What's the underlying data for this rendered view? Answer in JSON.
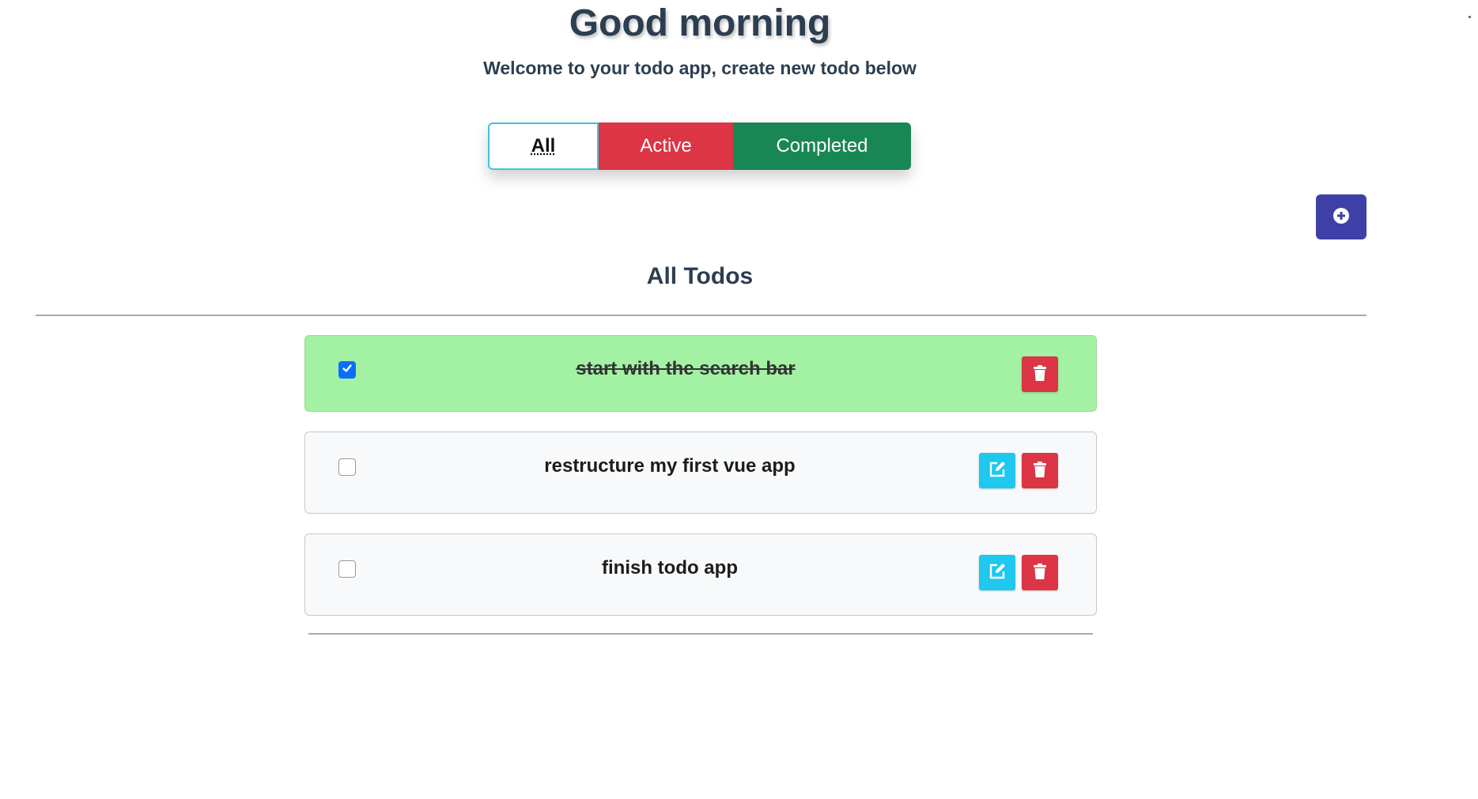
{
  "header": {
    "greeting": "Good morning",
    "subtitle": "Welcome to your todo app, create new todo below"
  },
  "filters": {
    "all_label": "All",
    "active_label": "Active",
    "completed_label": "Completed",
    "selected": "All"
  },
  "add_button": {
    "icon": "plus-circle-icon"
  },
  "list": {
    "title": "All Todos",
    "items": [
      {
        "text": "start with the search bar",
        "completed": true
      },
      {
        "text": "restructure my first vue app",
        "completed": false
      },
      {
        "text": "finish todo app",
        "completed": false
      }
    ]
  },
  "colors": {
    "active": "#dc3545",
    "completed": "#198754",
    "add_button": "#3f3fa8",
    "edit_button": "#1ec8ef",
    "completed_row": "#a3f2a3",
    "checkbox_checked": "#0d6efd"
  },
  "icons": {
    "edit": "edit-icon",
    "delete": "trash-icon",
    "check": "check-icon"
  }
}
